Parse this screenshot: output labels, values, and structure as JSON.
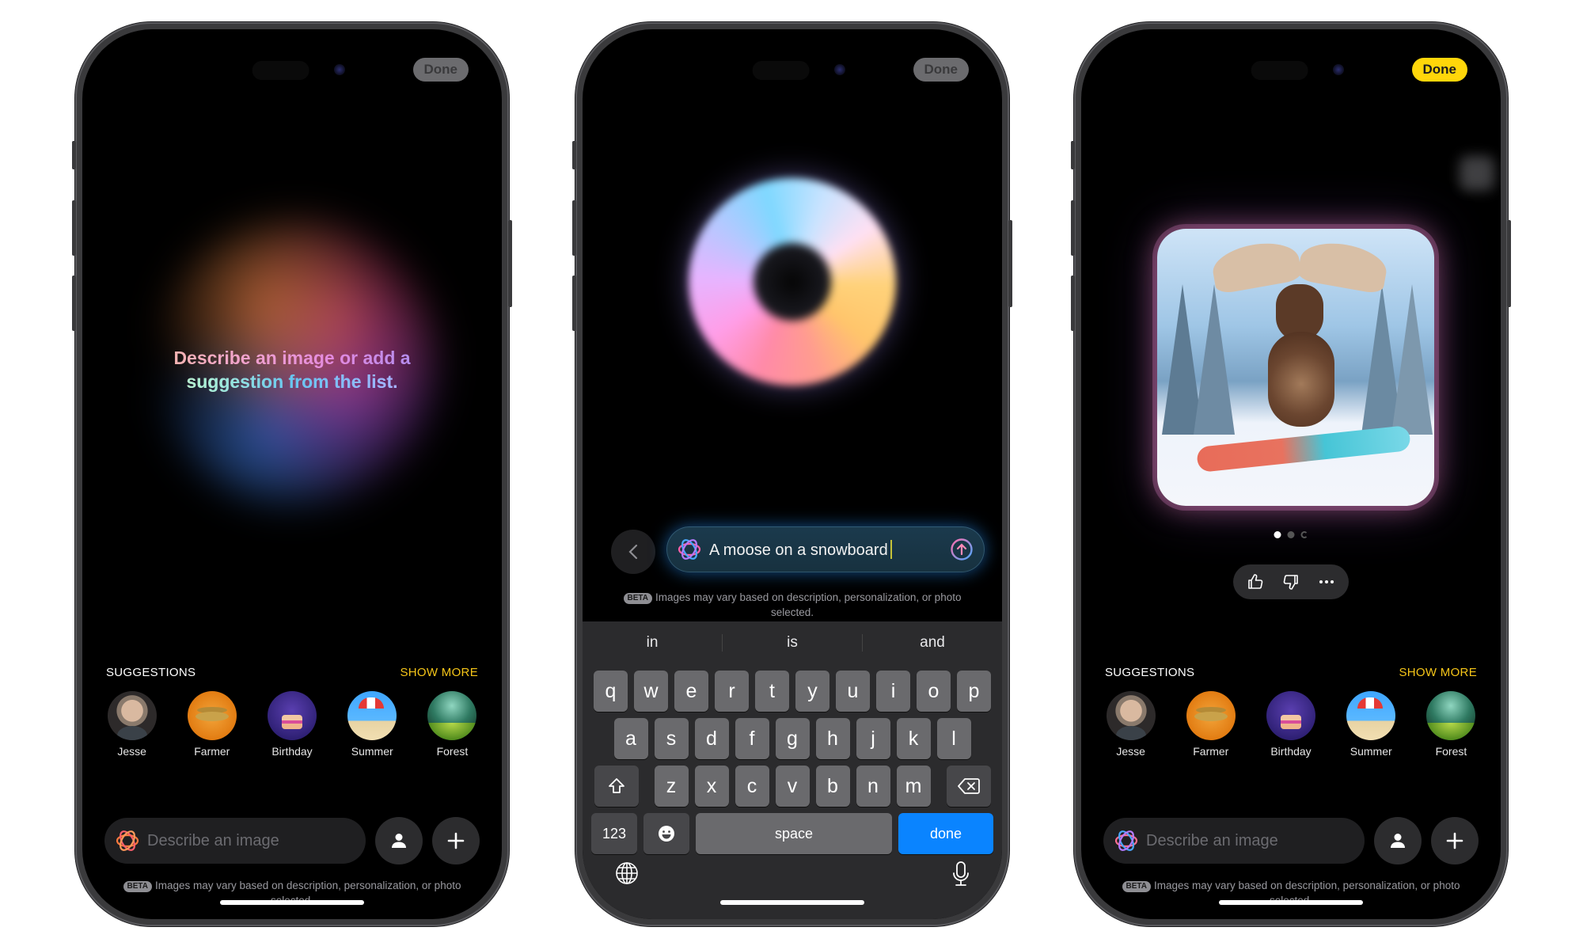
{
  "phones": {
    "left": {
      "done_label": "Done",
      "hint_line1": "Describe an image or add a",
      "hint_line2": "suggestion from the list.",
      "suggestions_title": "SUGGESTIONS",
      "show_more": "SHOW MORE",
      "suggestions": [
        {
          "label": "Jesse",
          "icon": "person-photo"
        },
        {
          "label": "Farmer",
          "icon": "hat-image"
        },
        {
          "label": "Birthday",
          "icon": "cake-image"
        },
        {
          "label": "Summer",
          "icon": "beach-umbrella-image"
        },
        {
          "label": "Forest",
          "icon": "forest-image"
        }
      ],
      "prompt_placeholder": "Describe an image",
      "beta_badge": "BETA",
      "beta_text": "Images may vary based on description, personalization, or photo selected."
    },
    "middle": {
      "done_label": "Done",
      "prompt_value": "A moose on a snowboard",
      "beta_badge": "BETA",
      "beta_text": "Images may vary based on description, personalization, or photo selected.",
      "keyboard": {
        "predictions": [
          "in",
          "is",
          "and"
        ],
        "row1": [
          "q",
          "w",
          "e",
          "r",
          "t",
          "y",
          "u",
          "i",
          "o",
          "p"
        ],
        "row2": [
          "a",
          "s",
          "d",
          "f",
          "g",
          "h",
          "j",
          "k",
          "l"
        ],
        "row3": [
          "z",
          "x",
          "c",
          "v",
          "b",
          "n",
          "m"
        ],
        "numbers_label": "123",
        "space_label": "space",
        "done_label": "done",
        "done_color": "#0a84ff"
      }
    },
    "right": {
      "done_label": "Done",
      "done_color": "#ffd60a",
      "generated_image_alt": "Moose on a snowboard",
      "page_indicator": {
        "current": 1,
        "total": 3
      },
      "suggestions_title": "SUGGESTIONS",
      "show_more": "SHOW MORE",
      "suggestions": [
        {
          "label": "Jesse",
          "icon": "person-photo"
        },
        {
          "label": "Farmer",
          "icon": "hat-image"
        },
        {
          "label": "Birthday",
          "icon": "cake-image"
        },
        {
          "label": "Summer",
          "icon": "beach-umbrella-image"
        },
        {
          "label": "Forest",
          "icon": "forest-image"
        }
      ],
      "prompt_placeholder": "Describe an image",
      "beta_badge": "BETA",
      "beta_text": "Images may vary based on description, personalization, or photo selected."
    }
  },
  "colors": {
    "accent_yellow": "#f5c518",
    "keyboard_blue": "#0a84ff"
  }
}
